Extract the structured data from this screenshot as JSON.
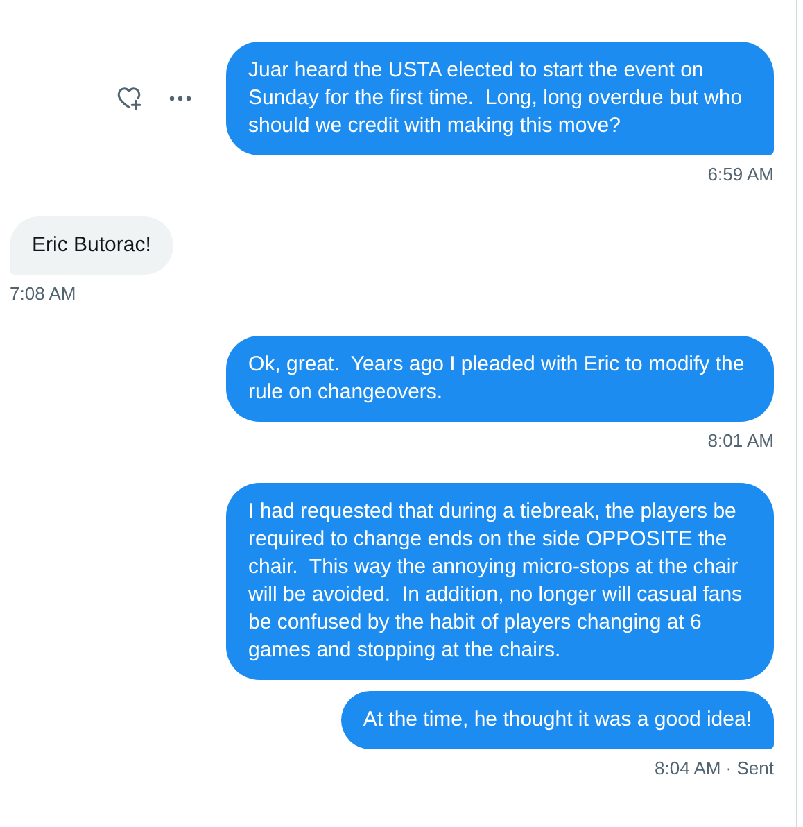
{
  "messages": [
    {
      "kind": "sent",
      "text": "Juar heard the USTA elected to start the event on Sunday for the first time.  Long, long overdue but who should we credit with making this move?",
      "time": "6:59 AM",
      "show_actions": true
    },
    {
      "kind": "received",
      "text": "Eric Butorac!",
      "time": "7:08 AM",
      "show_actions": false
    },
    {
      "kind": "sent",
      "text": "Ok, great.  Years ago I pleaded with Eric to modify the rule on changeovers.",
      "time": "8:01 AM",
      "show_actions": false
    },
    {
      "kind": "sent",
      "text": "I had requested that during a tiebreak, the players be required to change ends on the side OPPOSITE the chair.  This way the annoying micro-stops at the chair will be avoided.  In addition, no longer will casual fans be confused by the habit of players changing at 6 games and stopping at the chairs.",
      "show_actions": false
    },
    {
      "kind": "sent",
      "text": "At the time, he thought it was a good idea!",
      "time": "8:04 AM · Sent",
      "show_actions": false
    }
  ]
}
